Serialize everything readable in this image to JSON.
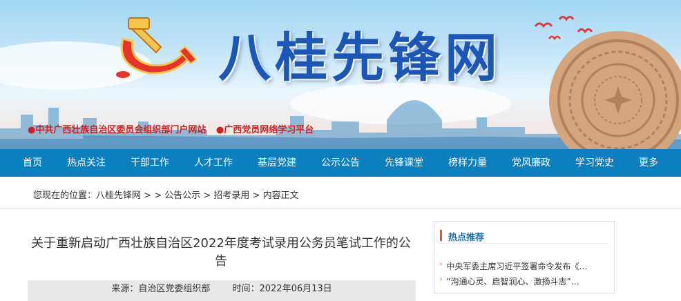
{
  "banner": {
    "site_title": "八桂先锋网",
    "link_1": "●中共广西壮族自治区委员会组织部门户网站",
    "link_2": "●广西党员网络学习平台"
  },
  "nav": {
    "items": [
      "首页",
      "热点关注",
      "干部工作",
      "人才工作",
      "基层党建",
      "公示公告",
      "先锋课堂",
      "榜样力量",
      "党风廉政",
      "学习党史",
      "更多"
    ]
  },
  "breadcrumb": {
    "prefix": "您现在的位置：",
    "items": [
      "八桂先锋网",
      "公告公示",
      "招考录用",
      "内容正文"
    ],
    "sep_1": " > > ",
    "sep_2": " > ",
    "sep_3": " > "
  },
  "article": {
    "title": "关于重新启动广西壮族自治区2022年度考试录用公务员笔试工作的公告",
    "source_label": "来源：自治区党委组织部",
    "time_label": "时间：2022年06月13日"
  },
  "sidebar": {
    "heading": "热点推荐",
    "items": [
      "中央军委主席习近平签署命令发布《…",
      "“沟通心灵、启智润心、激扬斗志”…"
    ]
  },
  "colors": {
    "nav_bg": "#0b7fc0",
    "title_blue": "#1c57b8",
    "link_red": "#d11e1e",
    "accent_orange": "#e05a1c"
  }
}
